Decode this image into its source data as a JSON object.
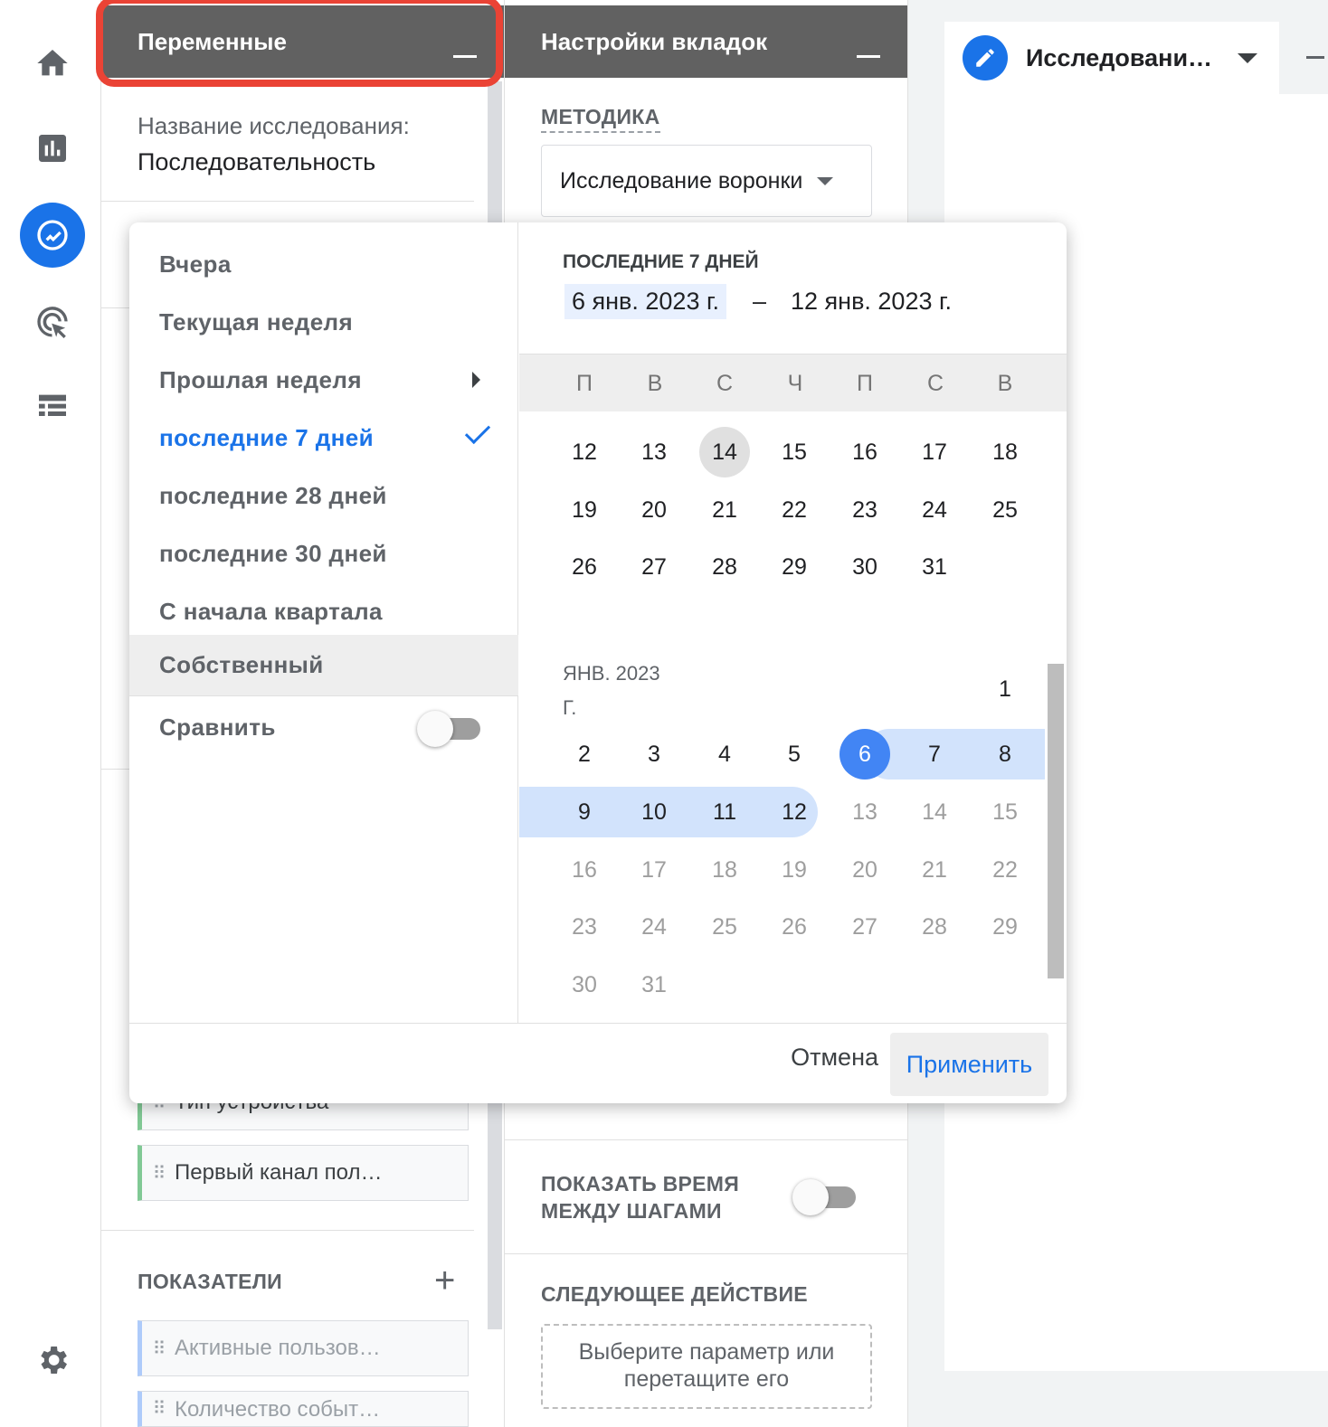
{
  "panels": {
    "variables": {
      "title": "Переменные",
      "exploration_name_label": "Название исследования:",
      "exploration_name_value": "Последовательность",
      "dimension_chips": [
        "Тип устройства",
        "Первый канал пол…"
      ],
      "metrics_label": "ПОКАЗАТЕЛИ",
      "metric_chips": [
        "Активные пользов…",
        "Количество событ…"
      ]
    },
    "tab_settings": {
      "title": "Настройки вкладок",
      "technique_label": "МЕТОДИКА",
      "technique_value": "Исследование воронки",
      "show_time_label_1": "ПОКАЗАТЬ ВРЕМЯ",
      "show_time_label_2": "МЕЖДУ ШАГАМИ",
      "next_action_label": "СЛЕДУЮЩЕЕ ДЕЙСТВИЕ",
      "drop_line_1": "Выберите параметр или",
      "drop_line_2": "перетащите его"
    }
  },
  "canvas": {
    "tab_label": "Исследовани…"
  },
  "date_picker": {
    "presets": [
      "Вчера",
      "Текущая неделя",
      "Прошлая неделя",
      "последние 7 дней",
      "последние 28 дней",
      "последние 30 дней",
      "С начала квартала",
      "Собственный"
    ],
    "selected_preset": "последние 7 дней",
    "compare_label": "Сравнить",
    "compare_enabled": false,
    "range_title": "ПОСЛЕДНИЕ 7 ДНЕЙ",
    "date_from": "6 янв. 2023 г.",
    "date_separator": "–",
    "date_to": "12 янв. 2023 г.",
    "weekdays": [
      "П",
      "В",
      "С",
      "Ч",
      "П",
      "С",
      "В"
    ],
    "prev_month_rows": [
      [
        "12",
        "13",
        "14",
        "15",
        "16",
        "17",
        "18"
      ],
      [
        "19",
        "20",
        "21",
        "22",
        "23",
        "24",
        "25"
      ],
      [
        "26",
        "27",
        "28",
        "29",
        "30",
        "31"
      ]
    ],
    "month_label_1": "ЯНВ. 2023",
    "month_label_2": "Г.",
    "jan_rows": [
      [
        "1"
      ],
      [
        "2",
        "3",
        "4",
        "5",
        "6",
        "7",
        "8"
      ],
      [
        "9",
        "10",
        "11",
        "12",
        "13",
        "14",
        "15"
      ],
      [
        "16",
        "17",
        "18",
        "19",
        "20",
        "21",
        "22"
      ],
      [
        "23",
        "24",
        "25",
        "26",
        "27",
        "28",
        "29"
      ],
      [
        "30",
        "31"
      ]
    ],
    "cancel_label": "Отмена",
    "apply_label": "Применить",
    "colors": {
      "accent": "#1a73e8",
      "range_band": "#d2e3fc",
      "start_day": "#4285f4"
    }
  }
}
